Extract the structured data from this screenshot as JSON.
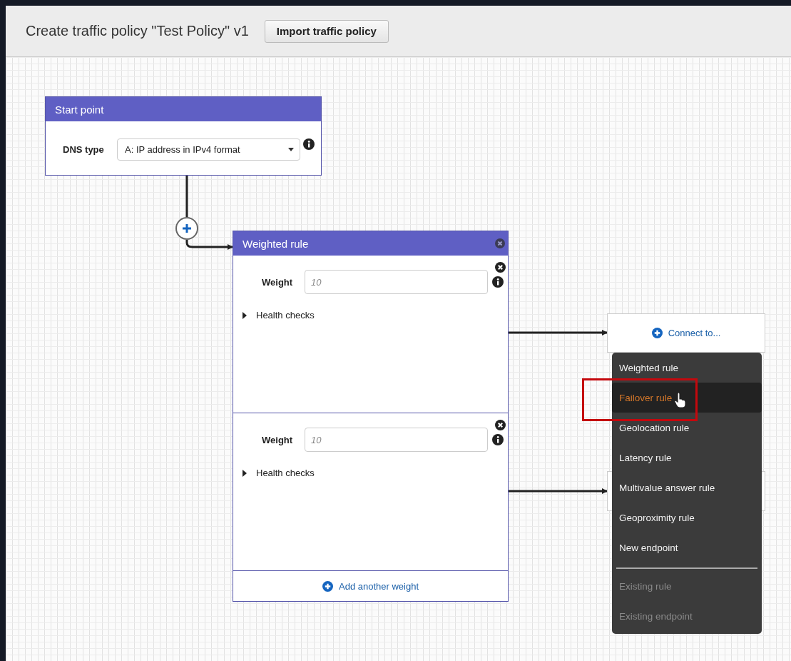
{
  "header": {
    "title": "Create traffic policy \"Test Policy\" v1",
    "import_button": "Import traffic policy"
  },
  "start_point": {
    "title": "Start point",
    "dns_type": {
      "label": "DNS type",
      "value": "A: IP address in IPv4 format"
    }
  },
  "weighted_rule": {
    "title": "Weighted rule",
    "add_button": "Add another weight",
    "weights": [
      {
        "label": "Weight",
        "placeholder": "10",
        "health_checks": "Health checks",
        "expanded": false
      },
      {
        "label": "Weight",
        "placeholder": "10",
        "health_checks": "Health checks",
        "expanded": false
      }
    ]
  },
  "connect_button": "Connect to...",
  "menu": {
    "items": [
      {
        "label": "Weighted rule",
        "selected": false,
        "disabled": false
      },
      {
        "label": "Failover rule",
        "selected": true,
        "disabled": false
      },
      {
        "label": "Geolocation rule",
        "selected": false,
        "disabled": false
      },
      {
        "label": "Latency rule",
        "selected": false,
        "disabled": false
      },
      {
        "label": "Multivalue answer rule",
        "selected": false,
        "disabled": false
      },
      {
        "label": "Geoproximity rule",
        "selected": false,
        "disabled": false
      },
      {
        "label": "New endpoint",
        "selected": false,
        "disabled": false
      },
      {
        "label": "Existing rule",
        "selected": false,
        "disabled": true
      },
      {
        "label": "Existing endpoint",
        "selected": false,
        "disabled": true
      }
    ]
  }
}
